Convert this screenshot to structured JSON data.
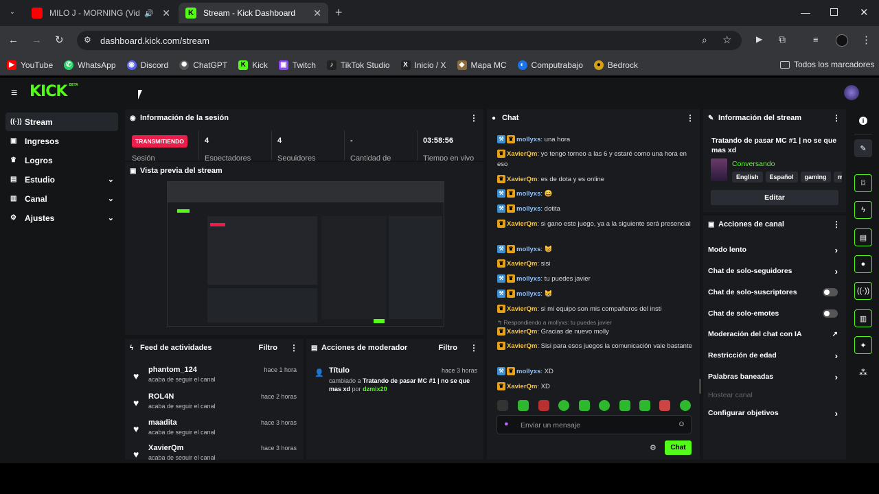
{
  "browser": {
    "tabs": [
      {
        "title": "MILO J - MORNING (Video",
        "favicon_color": "#ff0000",
        "audio": true
      },
      {
        "title": "Stream - Kick Dashboard",
        "favicon_color": "#53fc18"
      }
    ],
    "new_tab_label": "+",
    "url": "dashboard.kick.com/stream",
    "bookmarks": [
      {
        "label": "YouTube",
        "color": "#ff0000",
        "glyph": "▶"
      },
      {
        "label": "WhatsApp",
        "color": "#25d366",
        "glyph": "✆"
      },
      {
        "label": "Discord",
        "color": "#5865f2",
        "glyph": "◉"
      },
      {
        "label": "ChatGPT",
        "color": "#555555",
        "glyph": "✺"
      },
      {
        "label": "Kick",
        "color": "#53fc18",
        "glyph": "K"
      },
      {
        "label": "Twitch",
        "color": "#9146ff",
        "glyph": "▣"
      },
      {
        "label": "TikTok Studio",
        "color": "#222222",
        "glyph": "♪"
      },
      {
        "label": "Inicio / X",
        "color": "#222222",
        "glyph": "X"
      },
      {
        "label": "Mapa MC",
        "color": "#8a6a3a",
        "glyph": "◆"
      },
      {
        "label": "Computrabajo",
        "color": "#1a73e8",
        "glyph": "◐"
      },
      {
        "label": "Bedrock",
        "color": "#d4a017",
        "glyph": "●"
      }
    ],
    "all_bookmarks_label": "Todos los marcadores"
  },
  "app": {
    "logo": "KICK",
    "logo_badge": "BETA",
    "accent": "#53fc18",
    "sidebar": [
      {
        "label": "Stream",
        "icon": "(·)",
        "active": true,
        "chevron": false
      },
      {
        "label": "Ingresos",
        "icon": "▣",
        "active": false,
        "chevron": false
      },
      {
        "label": "Logros",
        "icon": "🏆",
        "active": false,
        "chevron": false
      },
      {
        "label": "Estudio",
        "icon": "▤",
        "active": false,
        "chevron": true
      },
      {
        "label": "Canal",
        "icon": "▥",
        "active": false,
        "chevron": true
      },
      {
        "label": "Ajustes",
        "icon": "⚙",
        "active": false,
        "chevron": true
      }
    ]
  },
  "session": {
    "title": "Información de la sesión",
    "status_badge": "TRANSMITIENDO",
    "status_label": "Sesión",
    "stats": [
      {
        "value": "4",
        "label": "Espectadores"
      },
      {
        "value": "4",
        "label": "Seguidores"
      },
      {
        "value": "-",
        "label": "Cantidad de"
      },
      {
        "value": "03:58:56",
        "label": "Tiempo en vivo"
      }
    ]
  },
  "preview": {
    "title": "Vista previa del stream"
  },
  "feed": {
    "title": "Feed de actividades",
    "filter": "Filtro",
    "items": [
      {
        "name": "phantom_124",
        "desc": "acaba de seguir el canal",
        "time": "hace 1 hora"
      },
      {
        "name": "ROL4N",
        "desc": "acaba de seguir el canal",
        "time": "hace 2 horas"
      },
      {
        "name": "maadita",
        "desc": "acaba de seguir el canal",
        "time": "hace 3 horas"
      },
      {
        "name": "XavierQm",
        "desc": "acaba de seguir el canal",
        "time": "hace 3 horas"
      }
    ]
  },
  "modactions": {
    "title": "Acciones de moderador",
    "filter": "Filtro",
    "item": {
      "title": "Título",
      "time": "hace 3 horas",
      "prefix": "cambiado a",
      "value": "Tratando de pasar MC #1 | no se que mas xd",
      "by": "por",
      "user": "dzmix20"
    }
  },
  "chat": {
    "title": "Chat",
    "messages": [
      {
        "user": "mollyxs",
        "color": "blue",
        "text": ": una hora"
      },
      {
        "user": "XavierQm",
        "color": "yellow",
        "text": ": yo tengo torneo a las 6 y estaré como una hora en eso"
      },
      {
        "user": "XavierQm",
        "color": "yellow",
        "text": ": es de dota y es online"
      },
      {
        "user": "mollyxs",
        "color": "blue",
        "text": ": 😀"
      },
      {
        "user": "mollyxs",
        "color": "blue",
        "text": ": dotita"
      },
      {
        "user": "XavierQm",
        "color": "yellow",
        "text": ": si gano este juego, ya a la siguiente será presencial"
      },
      {
        "user": "mollyxs",
        "color": "blue",
        "text": ": 😸"
      },
      {
        "user": "XavierQm",
        "color": "yellow",
        "text": ": sisi"
      },
      {
        "user": "mollyxs",
        "color": "blue",
        "text": ": tu puedes javier"
      },
      {
        "user": "mollyxs",
        "color": "blue",
        "text": ": 😸"
      },
      {
        "user": "XavierQm",
        "color": "yellow",
        "text": ": si mi equipo son mis compañeros del insti"
      },
      {
        "user": "XavierQm",
        "color": "yellow",
        "text": ": Gracias de nuevo molly"
      },
      {
        "user": "XavierQm",
        "color": "yellow",
        "text": ": Sisi para esos juegos la comunicación vale bastante"
      },
      {
        "user": "mollyxs",
        "color": "blue",
        "text": ": XD"
      },
      {
        "user": "XavierQm",
        "color": "yellow",
        "text": ": XD"
      }
    ],
    "reply_note": "Respondiendo a mollyxs: tu puedes javier",
    "input_placeholder": "Enviar un mensaje",
    "send_label": "Chat"
  },
  "stream_info": {
    "title": "Información del stream",
    "stream_title": "Tratando de pasar MC #1 | no se que mas xd",
    "category": "Conversando",
    "tags": [
      "English",
      "Español",
      "gaming",
      "m"
    ],
    "edit_label": "Editar"
  },
  "channel_actions": {
    "title": "Acciones de canal",
    "items": [
      {
        "label": "Modo lento",
        "control": "chevron"
      },
      {
        "label": "Chat de solo-seguidores",
        "control": "chevron"
      },
      {
        "label": "Chat de solo-suscriptores",
        "control": "toggle"
      },
      {
        "label": "Chat de solo-emotes",
        "control": "toggle"
      },
      {
        "label": "Moderación del chat con IA",
        "control": "external"
      },
      {
        "label": "Restricción de edad",
        "control": "chevron"
      },
      {
        "label": "Palabras baneadas",
        "control": "chevron"
      },
      {
        "label": "Hostear canal",
        "control": "none",
        "disabled": true
      },
      {
        "label": "Configurar objetivos",
        "control": "chevron"
      }
    ]
  }
}
